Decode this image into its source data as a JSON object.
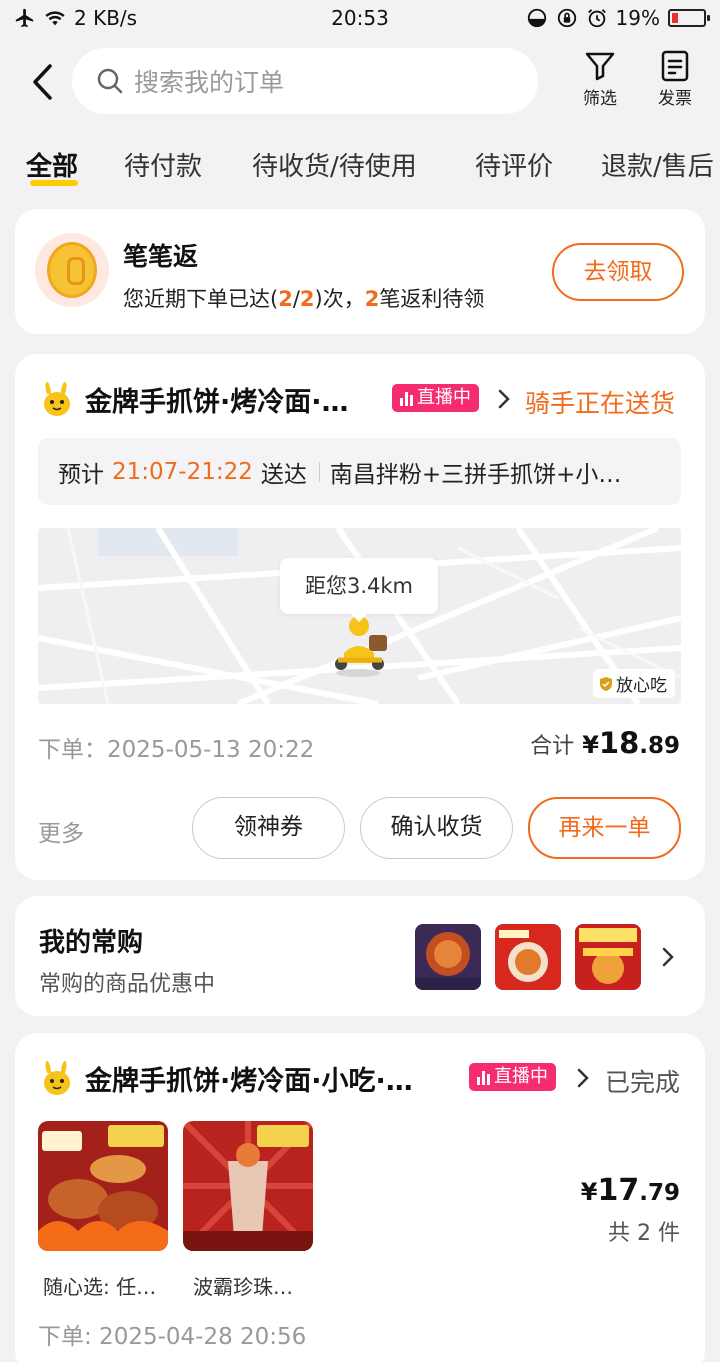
{
  "status_bar": {
    "network_speed": "2 KB/s",
    "time": "20:53",
    "battery": "19%",
    "battery_level": 0.19
  },
  "header": {
    "search_placeholder": "搜索我的订单",
    "filter_label": "筛选",
    "invoice_label": "发票"
  },
  "tabs": [
    "全部",
    "待付款",
    "待收货/待使用",
    "待评价",
    "退款/售后"
  ],
  "promo": {
    "title": "笔笔返",
    "desc_prefix": "您近期下单已达(",
    "count_a": "2",
    "slash": "/",
    "count_b": "2",
    "desc_mid": ")次，",
    "count_c": "2",
    "desc_suffix": "笔返利待领",
    "button": "去领取"
  },
  "order1": {
    "store_name": "金牌手抓饼·烤冷面·…",
    "live_badge": "直播中",
    "status": "骑手正在送货",
    "eta_prefix": "预计",
    "eta_time": "21:07-21:22",
    "eta_suffix": "送达",
    "items": "南昌拌粉+三拼手抓饼+小…",
    "distance": "距您3.4km",
    "safe_tag": "放心吃",
    "order_time": "下单：2025-05-13 20:22",
    "total_label": "合计",
    "currency": "¥",
    "total_int": "18",
    "total_dec": ".89",
    "more": "更多",
    "btn_coupon": "领神券",
    "btn_confirm": "确认收货",
    "btn_reorder": "再来一单"
  },
  "frequent": {
    "title": "我的常购",
    "subtitle": "常购的商品优惠中"
  },
  "order2": {
    "store_name": "金牌手抓饼·烤冷面·小吃·…",
    "live_badge": "直播中",
    "status": "已完成",
    "item1_label": "随心选: 任…",
    "item2_label": "波霸珍珠…",
    "currency": "¥",
    "price_int": "17",
    "price_dec": ".79",
    "count": "共 2 件",
    "order_time": "下单: 2025-04-28 20:56"
  },
  "colors": {
    "accent": "#f26a1b",
    "live": "#f52d6e",
    "tab_underline": "#ffcc00",
    "background": "#f2f2f4"
  }
}
